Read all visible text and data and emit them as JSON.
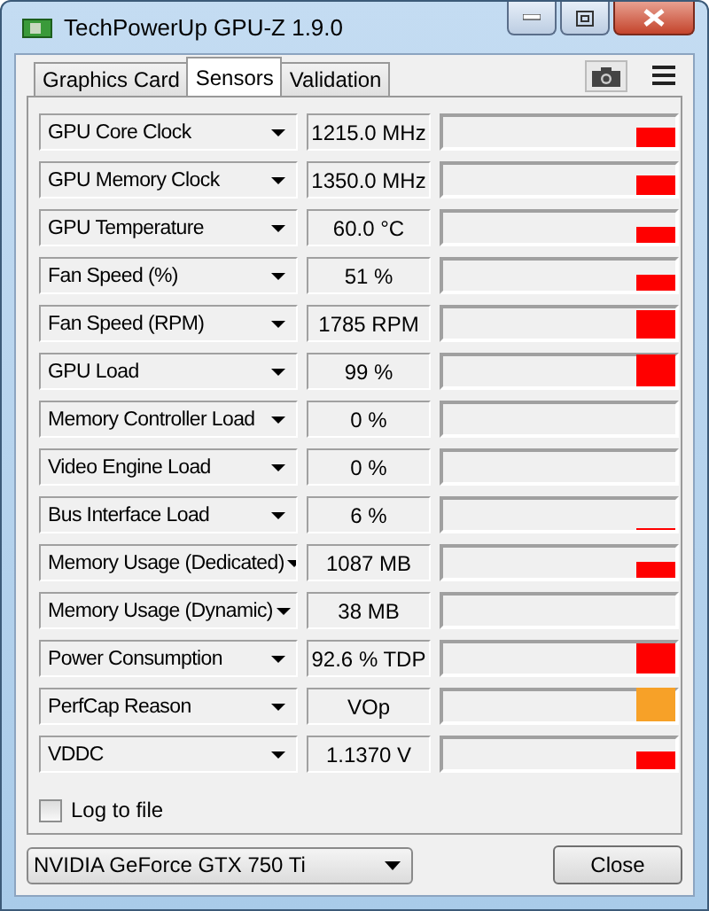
{
  "window": {
    "title": "TechPowerUp GPU-Z 1.9.0"
  },
  "tabs": [
    {
      "label": "Graphics Card",
      "selected": false
    },
    {
      "label": "Sensors",
      "selected": true
    },
    {
      "label": "Validation",
      "selected": false
    }
  ],
  "sensors": [
    {
      "name": "GPU Core Clock",
      "value": "1215.0 MHz",
      "color": "#ff0000"
    },
    {
      "name": "GPU Memory Clock",
      "value": "1350.0 MHz",
      "color": "#ff0000"
    },
    {
      "name": "GPU Temperature",
      "value": "60.0 °C",
      "color": "#ff0000"
    },
    {
      "name": "Fan Speed (%)",
      "value": "51 %",
      "color": "#ff0000"
    },
    {
      "name": "Fan Speed (RPM)",
      "value": "1785 RPM",
      "color": "#ff0000"
    },
    {
      "name": "GPU Load",
      "value": "99 %",
      "color": "#ff0000"
    },
    {
      "name": "Memory Controller Load",
      "value": "0 %"
    },
    {
      "name": "Video Engine Load",
      "value": "0 %"
    },
    {
      "name": "Bus Interface Load",
      "value": "6 %",
      "color": "#ff0000"
    },
    {
      "name": "Memory Usage (Dedicated)",
      "value": "1087 MB",
      "color": "#ff0000"
    },
    {
      "name": "Memory Usage (Dynamic)",
      "value": "38 MB"
    },
    {
      "name": "Power Consumption",
      "value": "92.6 % TDP",
      "color": "#ff0000"
    },
    {
      "name": "PerfCap Reason",
      "value": "VOp",
      "color": "#f7a128"
    },
    {
      "name": "VDDC",
      "value": "1.1370 V",
      "color": "#ff0000"
    }
  ],
  "log_to_file": {
    "label": "Log to file",
    "checked": false
  },
  "gpu_select": {
    "value": "NVIDIA GeForce GTX 750 Ti"
  },
  "buttons": [
    {
      "label": "Close"
    }
  ]
}
